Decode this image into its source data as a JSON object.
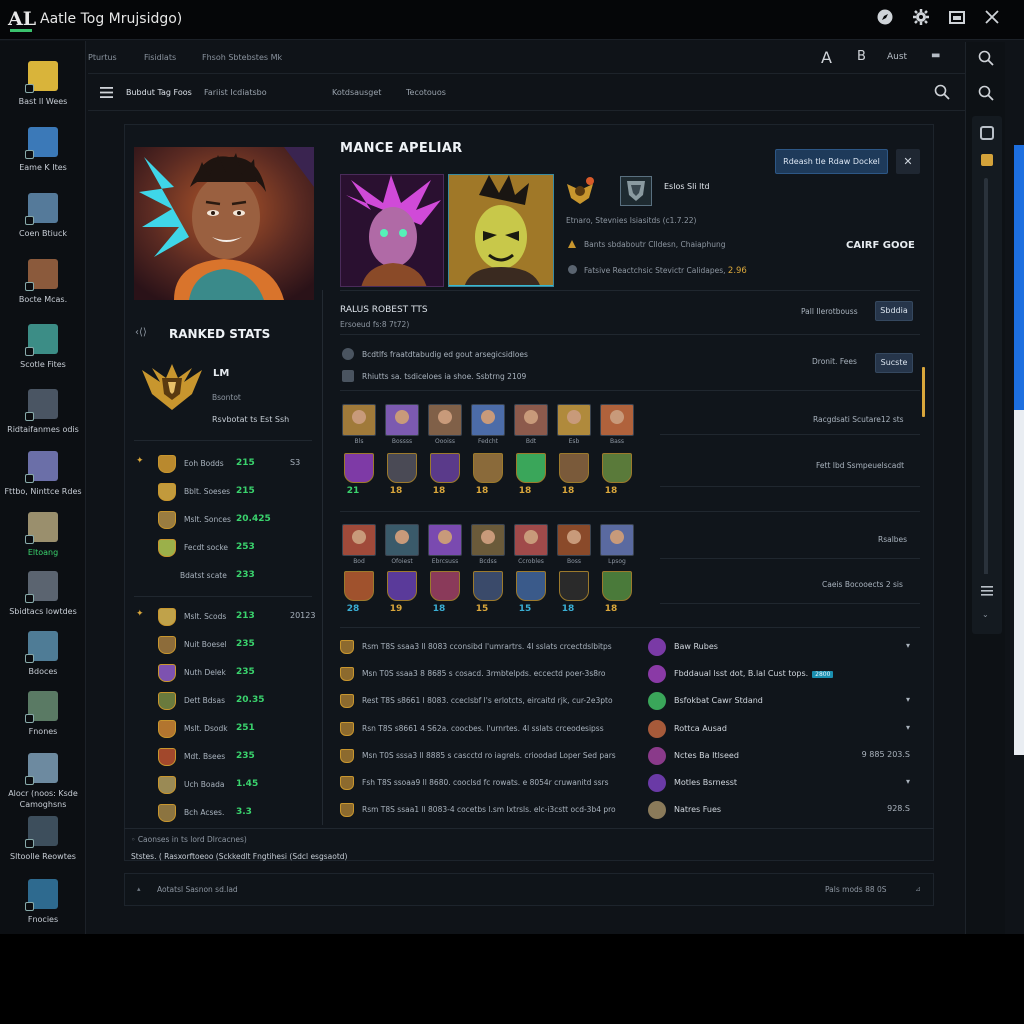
{
  "window": {
    "title": "Aatle Tog Mrujsidgo)",
    "logo": "AL",
    "controls": [
      "compass-icon",
      "settings-icon",
      "restore-icon",
      "close-icon"
    ]
  },
  "sidebar": {
    "items": [
      {
        "label": "Bast ll Wees",
        "color": "#d9b43a"
      },
      {
        "label": "Eame K Ites",
        "color": "#3b79b8"
      },
      {
        "label": "Coen Btiuck",
        "color": "#557a9a"
      },
      {
        "label": "Bocte Mcas.",
        "color": "#8b5a3c"
      },
      {
        "label": "Scotle Fites",
        "color": "#3c8d86"
      },
      {
        "label": "Ridtaifanmes odis",
        "color": "#4a5563"
      },
      {
        "label": "Fttbo, Ninttce Rdes",
        "color": "#6b6fa8"
      },
      {
        "label": "Eltoang",
        "color": "#9a8f6d",
        "green": true
      },
      {
        "label": "Sbidtacs lowtdes",
        "color": "#5b6470"
      },
      {
        "label": "Bdoces",
        "color": "#4f7c96"
      },
      {
        "label": "Fnones",
        "color": "#5a7a64"
      },
      {
        "label": "Alocr (noos: Ksde Camoghsns",
        "color": "#6d8aa0"
      },
      {
        "label": "Sltoolle Reowtes",
        "color": "#3d4e5c"
      },
      {
        "label": "Fnocies",
        "color": "#2e6a8f"
      }
    ]
  },
  "topnav": {
    "items": [
      "Pturtus",
      "Fisidlats",
      "Fhsoh Sbtebstes Mk"
    ],
    "right": [
      "A",
      "B",
      "Aust",
      "▬"
    ]
  },
  "subnav": {
    "title": "Bubdut Tag Foos",
    "items": [
      "Fariist  Icdiatsbo",
      "Kotdsausget",
      "Tecotouos"
    ]
  },
  "profile": {
    "heading": "MANCE APELIAR",
    "badge_title": "Eslos Sli ltd",
    "stat_line_1": "Etnaro, Stevnies Isiasitds (c1.7.22)",
    "stat_line_2": "Bants sbdaboutr Clldesn, Chaiaphung",
    "stat_line_3": "Fatsive Reactchsic Stevictr Calidapes, ",
    "stat_line_3_value": "2.96",
    "right_label": "CAIRF GOOE",
    "primary_button": "Rdeash tle Rdaw Dockel",
    "close_button": "✕"
  },
  "ranked": {
    "heading": "RANKED STATS",
    "tier": "LM",
    "tier_sub": "Bsontot",
    "tier_extra": "Rsvbotat ts Est Ssh",
    "group1": [
      {
        "label": "Eoh Bodds",
        "value": "215",
        "extra": "S3",
        "emblem": "#b9892e",
        "marker": true
      },
      {
        "label": "Bblt. Soeses",
        "value": "215",
        "emblem": "#c29a3c"
      },
      {
        "label": "Mslt. Sonces",
        "value": "20.425",
        "emblem": "#9a7c40"
      },
      {
        "label": "Fecdt socke",
        "value": "253",
        "emblem": "#9bb04a"
      },
      {
        "label": "Bdatst scate",
        "value": "233",
        "emblem": ""
      }
    ],
    "group2": [
      {
        "label": "Mslt. Scods",
        "value": "213",
        "extra": "20123",
        "emblem": "#c0a24a",
        "marker": true
      },
      {
        "label": "Nuit Boesel",
        "value": "235",
        "emblem": "#8d6c3a"
      },
      {
        "label": "Nuth Delek",
        "value": "235",
        "emblem": "#7d52b0"
      },
      {
        "label": "Dett Bdsas",
        "value": "20.35",
        "emblem": "#6a7a3d"
      },
      {
        "label": "Mslt. Dsodk",
        "value": "251",
        "emblem": "#b2752f"
      },
      {
        "label": "Mdt. Bsees",
        "value": "235",
        "emblem": "#a2482c"
      },
      {
        "label": "Uch Boada",
        "value": "1.45",
        "emblem": "#9a8a55"
      },
      {
        "label": "Bch Acses.",
        "value": "3.3",
        "emblem": "#8c7440"
      }
    ]
  },
  "recent": {
    "heading": "RALUS ROBEST TTS",
    "subheading": "Ersoeud fs:8 7t72)",
    "right_1": "Pall Ilerotbouss",
    "right_1_button": "Sbddia",
    "line_1": "Bcdtlfs fraatdtabudig ed gout arsegicsidloes",
    "line_2": "Rhiutts  sa.  tsdiceloes  ia  shoe.  Ssbtrng  2109",
    "right_2": "Dronit. Fees",
    "right_2_button": "Sucste",
    "row1_right": "Racgdsati Scutare12 sts",
    "row2_right": "Fett Ibd Ssmpeuelscadt",
    "row3_right": "Rsalbes",
    "row4_right": "Caeis Bocooects 2 sis"
  },
  "champs_row1": [
    {
      "name": "Bls",
      "color": "#a07a3a"
    },
    {
      "name": "Bossss",
      "color": "#7c5ab0"
    },
    {
      "name": "Oooiss",
      "color": "#806048"
    },
    {
      "name": "Fedcht",
      "color": "#4c6ca8"
    },
    {
      "name": "Bdt",
      "color": "#8c5a4c"
    },
    {
      "name": "Esb",
      "color": "#b08a3c"
    },
    {
      "name": "Bass",
      "color": "#b0623c"
    }
  ],
  "crests_row1": [
    {
      "value": "21",
      "color": "#7e3aa6",
      "text": "#3ad36d"
    },
    {
      "value": "18",
      "color": "#4a4a55",
      "text": "#d9a63b"
    },
    {
      "value": "18",
      "color": "#5a3a8a",
      "text": "#d9a63b"
    },
    {
      "value": "18",
      "color": "#8a6a3a",
      "text": "#d9a63b"
    },
    {
      "value": "18",
      "color": "#3aa65a",
      "text": "#d9a63b"
    },
    {
      "value": "18",
      "color": "#7a5a3a",
      "text": "#d9a63b"
    },
    {
      "value": "18",
      "color": "#5a7a3a",
      "text": "#d9a63b"
    }
  ],
  "champs_row2": [
    {
      "name": "Bod",
      "color": "#a04a3a"
    },
    {
      "name": "Ofoiest",
      "color": "#3a5a6a"
    },
    {
      "name": "Ebrcsuss",
      "color": "#7a4ab0"
    },
    {
      "name": "Bcdss",
      "color": "#6a5a3a"
    },
    {
      "name": "Ccrobles",
      "color": "#a04a4a"
    },
    {
      "name": "Boss",
      "color": "#8a4a2a"
    },
    {
      "name": "Lpsog",
      "color": "#5a6aa0"
    }
  ],
  "crests_row2": [
    {
      "value": "28",
      "color": "#a0522d",
      "text": "#3aaed3"
    },
    {
      "value": "19",
      "color": "#5a3a9a",
      "text": "#d9a63b"
    },
    {
      "value": "18",
      "color": "#8a3a5a",
      "text": "#3aaed3"
    },
    {
      "value": "15",
      "color": "#3a4a6a",
      "text": "#d9a63b"
    },
    {
      "value": "15",
      "color": "#3a5a8a",
      "text": "#3aaed3"
    },
    {
      "value": "18",
      "color": "#2a2a2a",
      "text": "#3aaed3"
    },
    {
      "value": "18",
      "color": "#4a7a3a",
      "text": "#d9a63b"
    }
  ],
  "matches": [
    {
      "text": "Rsm T8S ssaa3 ll 8083 cconsibd l'umrartrs. 4l sslats crcectdslbitps",
      "name": "Baw Rubes",
      "right": "▾",
      "avatar": "#7a3aa6"
    },
    {
      "text": "Msn T0S ssaa3 8 8685 s cosacd. 3rmbtelpds. eccectd poer-3s8ro",
      "name": "Fbddaual lsst dot, B.lal Cust tops.",
      "tag": "2800",
      "right": "",
      "avatar": "#8a3aa6"
    },
    {
      "text": "Rest T8S s8661 l 8083. cceclsbf l's erlotcts, eircaitd rjk, cur-2e3pto",
      "name": "Bsfokbat Cawr Stdand",
      "right": "▾",
      "avatar": "#3aa65a"
    },
    {
      "text": "Rsn T8S s8661 4 S62a. coocbes. l'urnrtes. 4l sslats crceodesipss",
      "name": "Rottca Ausad",
      "right": "▾",
      "avatar": "#a65a3a"
    },
    {
      "text": "Msn T0S sssa3 ll 8885 s cascctd ro iagrels. crioodad Loper Sed pars",
      "name": "Nctes Ba Itlseed",
      "right": "9 885 203.S",
      "avatar": "#8a3a8a"
    },
    {
      "text": "Fsh T8S ssoaa9 ll 8680. cooclsd fc rowats. e 8054r cruwanitd ssrs",
      "name": "Motles Bsrnesst",
      "right": "▾",
      "avatar": "#6a3aa6"
    },
    {
      "text": "Rsm T8S ssaa1 ll 8083-4 cocetbs l.sm Ixtrsls. elc-i3cstt ocd-3b4 pro",
      "name": "Natres Fues",
      "right": "928.S",
      "avatar": "#8a7a5a"
    }
  ],
  "bottom": {
    "line_1": "Caonses in ts lord Dlrcacnes)",
    "line_2": "Ststes.  (  Rasxorftoeoo  (Sckkedlt  Fngtihesi  (Sdcl  esgsaotd)"
  },
  "footer": {
    "left": "Aotatsl Sasnon sd.lad",
    "right": "Pals mods 88 0S"
  }
}
